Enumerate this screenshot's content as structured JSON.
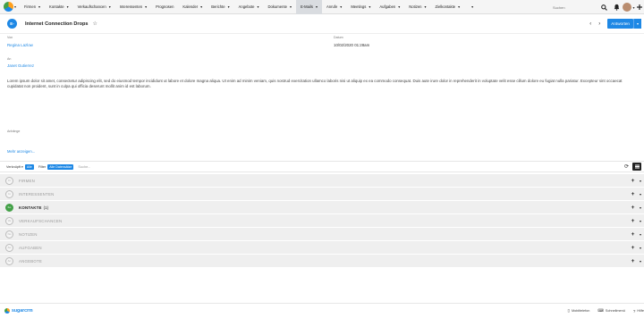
{
  "topnav": {
    "items": [
      {
        "label": "Firmen",
        "active": false
      },
      {
        "label": "Kontakte",
        "active": false
      },
      {
        "label": "Verkaufschancen",
        "active": false
      },
      {
        "label": "Interessenten",
        "active": false
      },
      {
        "label": "Prognosen",
        "active": false
      },
      {
        "label": "Kalender",
        "active": false
      },
      {
        "label": "Berichte",
        "active": false
      },
      {
        "label": "Angebote",
        "active": false
      },
      {
        "label": "Dokumente",
        "active": false
      },
      {
        "label": "E-Mails",
        "active": true
      },
      {
        "label": "Anrufe",
        "active": false
      },
      {
        "label": "Meetings",
        "active": false
      },
      {
        "label": "Aufgaben",
        "active": false
      },
      {
        "label": "Notizen",
        "active": false
      },
      {
        "label": "Zielkontakte",
        "active": false
      }
    ],
    "search_placeholder": "Suchen"
  },
  "record": {
    "badge": "E-",
    "title": "Internet Connection Drops",
    "reply_label": "Antworten"
  },
  "fields": {
    "from_label": "Von",
    "from_value": "Regina Lazlow",
    "date_label": "Datum",
    "date_value": "10/02/2020 01:28am",
    "to_label": "An",
    "to_value": "Janet Gutierrez",
    "body": "Lorem ipsum dolor sit amet, consectetur adipiscing elit, sed do eiusmod tempor incididunt ut labore et dolore magna aliqua. Ut enim ad minim veniam, quis nostrud exercitation ullamco laboris nisi ut aliquip ex ea commodo consequat. Duis aute irure dolor in reprehenderit in voluptate velit esse cillum dolore eu fugiat nulla pariatur. Excepteur sint occaecat cupidatat non proident, sunt in culpa qui officia deserunt mollit anim id est laborum.",
    "attachments_label": "Anhänge",
    "more_link": "Mehr anzeigen..."
  },
  "filterbar": {
    "linked_label": "Verknüpft",
    "linked_pill": "Alle",
    "filter_label": "Filter",
    "filter_pill": "Alle Datensätze",
    "search_placeholder": "Suche..."
  },
  "subpanels": [
    {
      "abbr": "Fi",
      "title": "FIRMEN",
      "count": "",
      "active": false
    },
    {
      "abbr": "In",
      "title": "INTERESSENTEN",
      "count": "",
      "active": false
    },
    {
      "abbr": "Ko",
      "title": "KONTAKTE",
      "count": "(1)",
      "active": true
    },
    {
      "abbr": "Ve",
      "title": "VERKAUFSCHANCEN",
      "count": "",
      "active": false
    },
    {
      "abbr": "No",
      "title": "NOTIZEN",
      "count": "",
      "active": false
    },
    {
      "abbr": "Au",
      "title": "AUFGABEN",
      "count": "",
      "active": false
    },
    {
      "abbr": "An",
      "title": "ANGEBOTE",
      "count": "",
      "active": false
    }
  ],
  "footer": {
    "brand": "sugarcrm",
    "mobile_label": "Mobiltelefon",
    "shortcuts_label": "Schnellmenü",
    "help_label": "Hilfe"
  },
  "colors": {
    "accent": "#1e88e5",
    "active_green": "#43a047",
    "panel_bg": "#efefef"
  }
}
